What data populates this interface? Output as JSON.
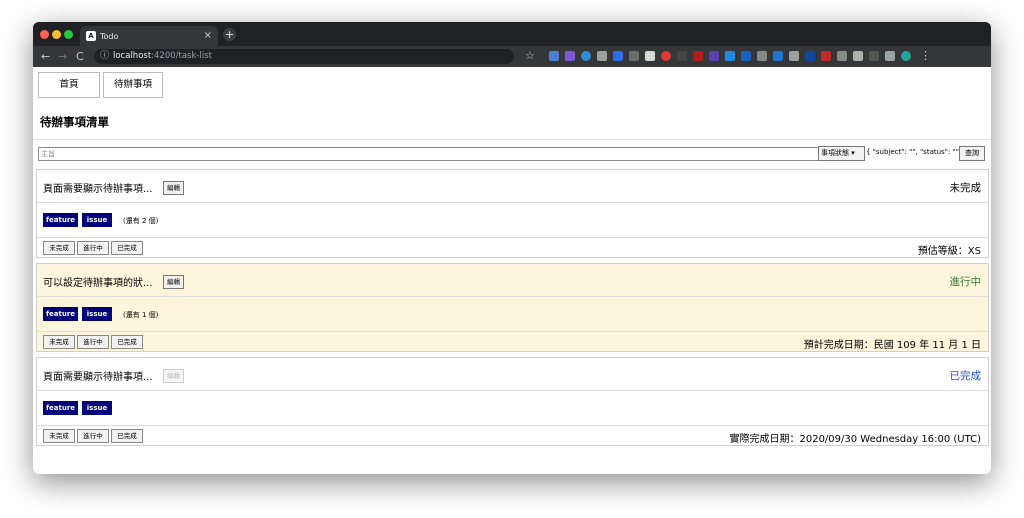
{
  "browser": {
    "tab_title": "Todo",
    "tab_favicon": "A",
    "url_host": "localhost",
    "url_path": ":4200/task-list"
  },
  "nav": {
    "home": "首頁",
    "todo": "待辦事項"
  },
  "page_title": "待辦事項清單",
  "search": {
    "placeholder": "主旨",
    "status_select": "事項狀態",
    "query_json": "{ \"subject\": \"\", \"status\": \"\" }",
    "query_button": "查詢"
  },
  "status_buttons": [
    "未完成",
    "進行中",
    "已完成"
  ],
  "edit_label": "編輯",
  "tasks": [
    {
      "subject": "頁面需要顯示待辦事項...",
      "status": "未完成",
      "status_color": "#000000",
      "bg": "#ffffff",
      "tags": [
        "feature",
        "issue"
      ],
      "more": "(還有 2 個)",
      "info": "預估等級：XS",
      "edit_disabled": false
    },
    {
      "subject": "可以設定待辦事項的狀...",
      "status": "進行中",
      "status_color": "#2e7d32",
      "bg": "#fdf6dc",
      "tags": [
        "feature",
        "issue"
      ],
      "more": "(還有 1 個)",
      "info": "預計完成日期：民國 109 年 11 月 1 日",
      "edit_disabled": false
    },
    {
      "subject": "頁面需要顯示待辦事項...",
      "status": "已完成",
      "status_color": "#1a4fd6",
      "bg": "#ffffff",
      "tags": [
        "feature",
        "issue"
      ],
      "more": "",
      "info": "實際完成日期：2020/09/30 Wednesday 16:00 (UTC)",
      "edit_disabled": true
    }
  ],
  "colors": {
    "tag_bg": "#00007a",
    "chrome_dark": "#202124",
    "toolbar": "#35363a"
  }
}
